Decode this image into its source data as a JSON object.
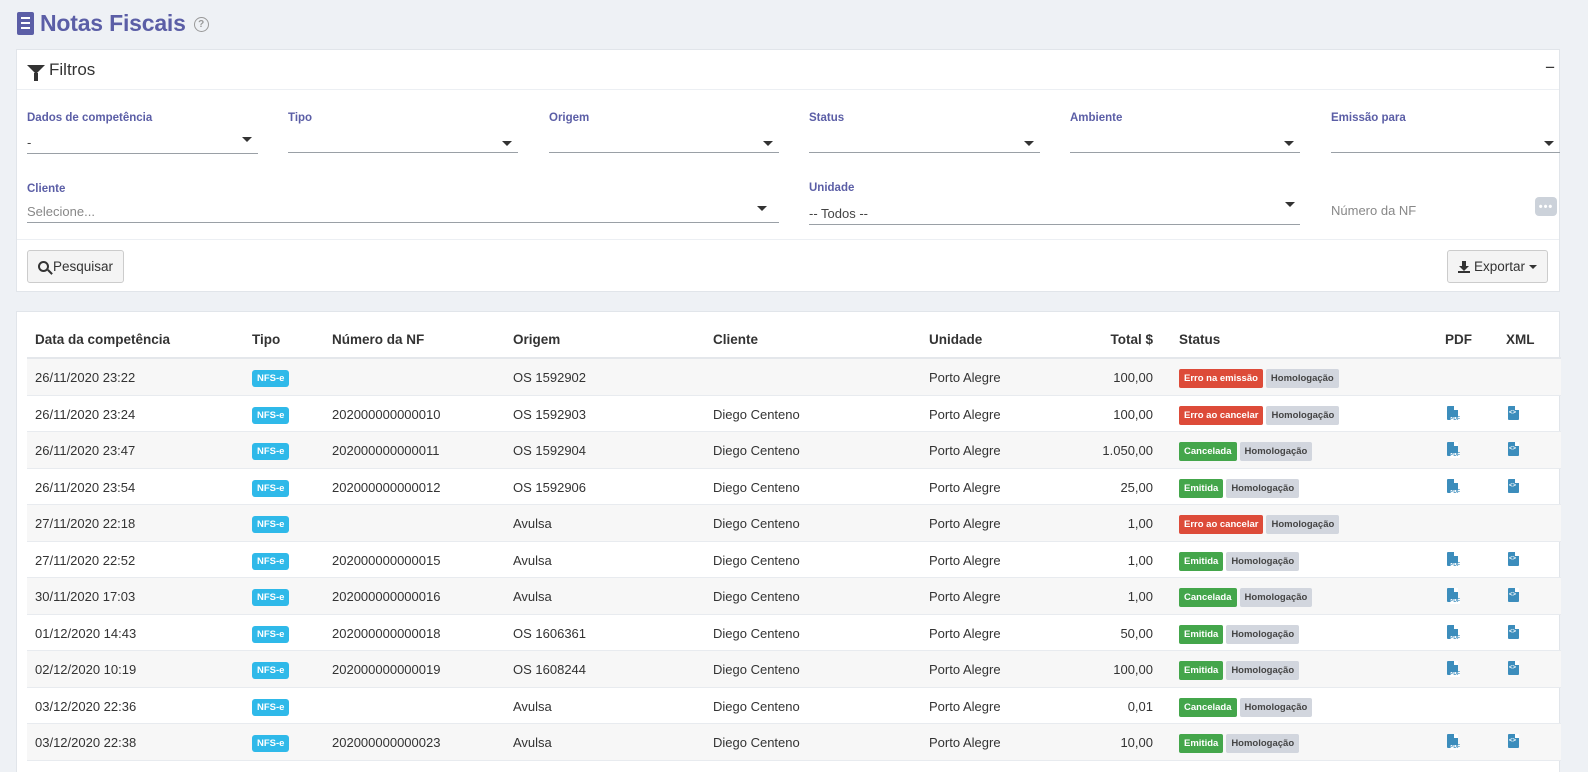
{
  "header": {
    "title": "Notas Fiscais",
    "help": "?"
  },
  "filters": {
    "title": "Filtros",
    "collapse": "−",
    "fields": {
      "competencia": {
        "label": "Dados de competência",
        "value": "-"
      },
      "tipo": {
        "label": "Tipo",
        "value": ""
      },
      "origem": {
        "label": "Origem",
        "value": ""
      },
      "status": {
        "label": "Status",
        "value": ""
      },
      "ambiente": {
        "label": "Ambiente",
        "value": ""
      },
      "emissao": {
        "label": "Emissão para",
        "value": ""
      },
      "cliente": {
        "label": "Cliente",
        "placeholder": "Selecione..."
      },
      "unidade": {
        "label": "Unidade",
        "value": "-- Todos --"
      },
      "numero": {
        "placeholder": "Número da NF",
        "button": "•••"
      }
    },
    "search_button": "Pesquisar",
    "export_button": "Exportar"
  },
  "table": {
    "columns": {
      "date": "Data da competência",
      "tipo": "Tipo",
      "numero": "Número da NF",
      "origem": "Origem",
      "cliente": "Cliente",
      "unidade": "Unidade",
      "total": "Total $",
      "status": "Status",
      "pdf": "PDF",
      "xml": "XML"
    },
    "rows": [
      {
        "date": "26/11/2020 23:22",
        "tipo": "NFS-e",
        "numero": "",
        "origem": "OS 1592902",
        "cliente": "",
        "unidade": "Porto Alegre",
        "total": "100,00",
        "status": "Erro na emissão",
        "status_color": "#dd4b39",
        "ambiente": "Homologação",
        "pdf": false,
        "xml": false
      },
      {
        "date": "26/11/2020 23:24",
        "tipo": "NFS-e",
        "numero": "202000000000010",
        "origem": "OS 1592903",
        "cliente": "Diego Centeno",
        "unidade": "Porto Alegre",
        "total": "100,00",
        "status": "Erro ao cancelar",
        "status_color": "#dd4b39",
        "ambiente": "Homologação",
        "pdf": true,
        "xml": true
      },
      {
        "date": "26/11/2020 23:47",
        "tipo": "NFS-e",
        "numero": "202000000000011",
        "origem": "OS 1592904",
        "cliente": "Diego Centeno",
        "unidade": "Porto Alegre",
        "total": "1.050,00",
        "status": "Cancelada",
        "status_color": "#44a64b",
        "ambiente": "Homologação",
        "pdf": true,
        "xml": true
      },
      {
        "date": "26/11/2020 23:54",
        "tipo": "NFS-e",
        "numero": "202000000000012",
        "origem": "OS 1592906",
        "cliente": "Diego Centeno",
        "unidade": "Porto Alegre",
        "total": "25,00",
        "status": "Emitida",
        "status_color": "#44a64b",
        "ambiente": "Homologação",
        "pdf": true,
        "xml": true
      },
      {
        "date": "27/11/2020 22:18",
        "tipo": "NFS-e",
        "numero": "",
        "origem": "Avulsa",
        "cliente": "Diego Centeno",
        "unidade": "Porto Alegre",
        "total": "1,00",
        "status": "Erro ao cancelar",
        "status_color": "#dd4b39",
        "ambiente": "Homologação",
        "pdf": false,
        "xml": false
      },
      {
        "date": "27/11/2020 22:52",
        "tipo": "NFS-e",
        "numero": "202000000000015",
        "origem": "Avulsa",
        "cliente": "Diego Centeno",
        "unidade": "Porto Alegre",
        "total": "1,00",
        "status": "Emitida",
        "status_color": "#44a64b",
        "ambiente": "Homologação",
        "pdf": true,
        "xml": true
      },
      {
        "date": "30/11/2020 17:03",
        "tipo": "NFS-e",
        "numero": "202000000000016",
        "origem": "Avulsa",
        "cliente": "Diego Centeno",
        "unidade": "Porto Alegre",
        "total": "1,00",
        "status": "Cancelada",
        "status_color": "#44a64b",
        "ambiente": "Homologação",
        "pdf": true,
        "xml": true
      },
      {
        "date": "01/12/2020 14:43",
        "tipo": "NFS-e",
        "numero": "202000000000018",
        "origem": "OS 1606361",
        "cliente": "Diego Centeno",
        "unidade": "Porto Alegre",
        "total": "50,00",
        "status": "Emitida",
        "status_color": "#44a64b",
        "ambiente": "Homologação",
        "pdf": true,
        "xml": true
      },
      {
        "date": "02/12/2020 10:19",
        "tipo": "NFS-e",
        "numero": "202000000000019",
        "origem": "OS 1608244",
        "cliente": "Diego Centeno",
        "unidade": "Porto Alegre",
        "total": "100,00",
        "status": "Emitida",
        "status_color": "#44a64b",
        "ambiente": "Homologação",
        "pdf": true,
        "xml": true
      },
      {
        "date": "03/12/2020 22:36",
        "tipo": "NFS-e",
        "numero": "",
        "origem": "Avulsa",
        "cliente": "Diego Centeno",
        "unidade": "Porto Alegre",
        "total": "0,01",
        "status": "Cancelada",
        "status_color": "#44a64b",
        "ambiente": "Homologação",
        "pdf": false,
        "xml": false
      },
      {
        "date": "03/12/2020 22:38",
        "tipo": "NFS-e",
        "numero": "202000000000023",
        "origem": "Avulsa",
        "cliente": "Diego Centeno",
        "unidade": "Porto Alegre",
        "total": "10,00",
        "status": "Emitida",
        "status_color": "#44a64b",
        "ambiente": "Homologação",
        "pdf": true,
        "xml": true
      }
    ]
  }
}
